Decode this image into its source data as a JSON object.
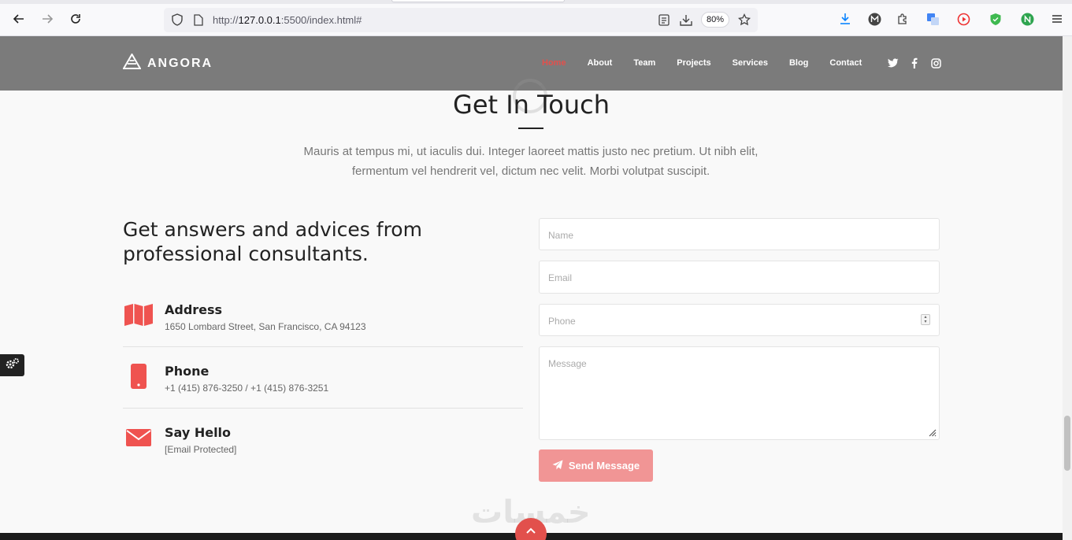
{
  "browser": {
    "url_prefix": "http://",
    "url_host": "127.0.0.1",
    "url_rest": ":5500/index.html#",
    "zoom": "80%"
  },
  "header": {
    "logo_text": "ANGORA",
    "nav": [
      "Home",
      "About",
      "Team",
      "Projects",
      "Services",
      "Blog",
      "Contact"
    ],
    "active_nav": "Home",
    "social_icons": [
      "twitter-icon",
      "facebook-icon",
      "instagram-icon"
    ]
  },
  "main": {
    "title": "Get In Touch",
    "subtitle": "Mauris at tempus mi, ut iaculis dui. Integer laoreet mattis justo nec pretium. Ut nibh elit, fermentum vel hendrerit vel, dictum nec velit. Morbi volutpat suscipit.",
    "left_heading": "Get answers and advices from professional consultants.",
    "info": [
      {
        "label": "Address",
        "value": "1650 Lombard Street, San Francisco, CA 94123",
        "icon": "map-icon"
      },
      {
        "label": "Phone",
        "value": "+1 (415) 876-3250 / +1 (415) 876-3251",
        "icon": "mobile-icon"
      },
      {
        "label": "Say Hello",
        "value": "[Email Protected]",
        "icon": "envelope-icon"
      }
    ]
  },
  "form": {
    "name_placeholder": "Name",
    "email_placeholder": "Email",
    "phone_placeholder": "Phone",
    "message_placeholder": "Message",
    "send_label": "Send Message"
  },
  "colors": {
    "accent": "#e2504c",
    "header_bg": "#7b7b7b",
    "button_bg": "#f19595"
  }
}
